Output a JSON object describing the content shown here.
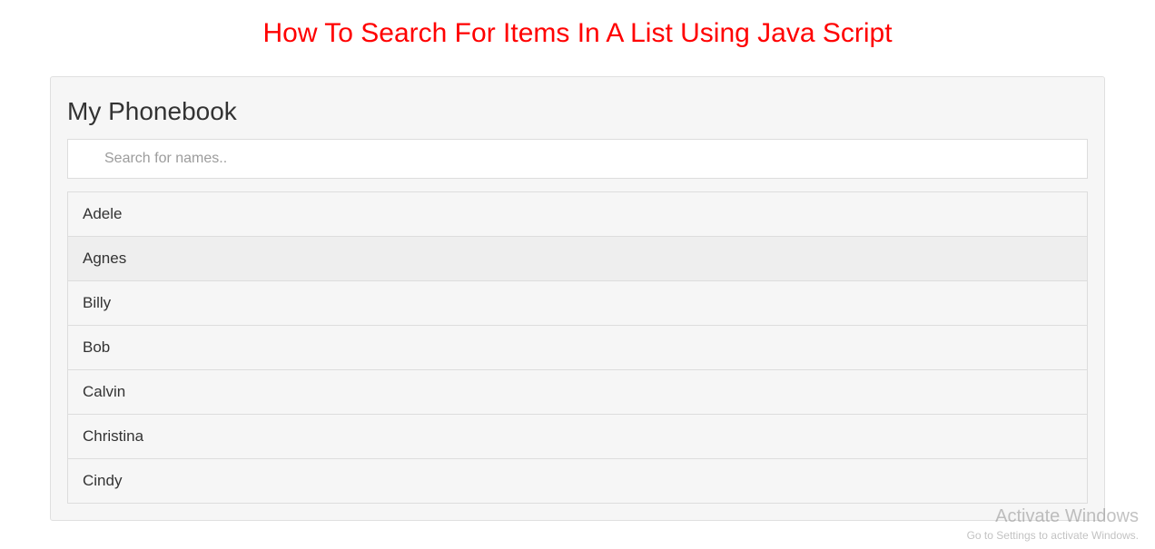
{
  "header": {
    "page_title": "How To Search For Items In A List Using Java Script"
  },
  "main": {
    "section_heading": "My Phonebook",
    "search": {
      "placeholder": "Search for names..",
      "value": ""
    },
    "names": [
      {
        "label": "Adele",
        "hovered": false
      },
      {
        "label": "Agnes",
        "hovered": true
      },
      {
        "label": "Billy",
        "hovered": false
      },
      {
        "label": "Bob",
        "hovered": false
      },
      {
        "label": "Calvin",
        "hovered": false
      },
      {
        "label": "Christina",
        "hovered": false
      },
      {
        "label": "Cindy",
        "hovered": false
      }
    ]
  },
  "watermark": {
    "title": "Activate Windows",
    "subtitle": "Go to Settings to activate Windows."
  }
}
